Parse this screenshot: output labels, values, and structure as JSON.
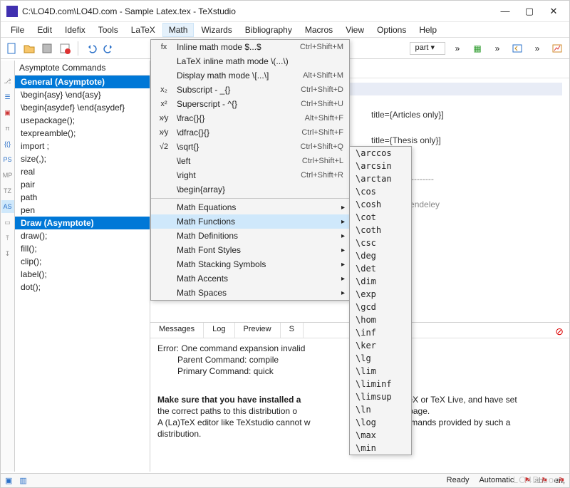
{
  "window": {
    "title": "C:\\LO4D.com\\LO4D.com - Sample Latex.tex - TeXstudio"
  },
  "menu": [
    "File",
    "Edit",
    "Idefix",
    "Tools",
    "LaTeX",
    "Math",
    "Wizards",
    "Bibliography",
    "Macros",
    "View",
    "Options",
    "Help"
  ],
  "toolbar_select": "part",
  "cmds": {
    "header": "Asymptote Commands",
    "items": [
      {
        "label": "General (Asymptote)",
        "group": true
      },
      {
        "label": "\\begin{asy} \\end{asy}"
      },
      {
        "label": "\\begin{asydef} \\end{asydef}"
      },
      {
        "label": "usepackage();"
      },
      {
        "label": "texpreamble();"
      },
      {
        "label": "import ;"
      },
      {
        "label": "size(,);"
      },
      {
        "label": "real"
      },
      {
        "label": "pair"
      },
      {
        "label": "path"
      },
      {
        "label": "pen"
      },
      {
        "label": "Draw (Asymptote)",
        "group": true
      },
      {
        "label": "draw();"
      },
      {
        "label": "fill();"
      },
      {
        "label": "clip();"
      },
      {
        "label": "label();"
      },
      {
        "label": "dot();"
      }
    ]
  },
  "left_icons": [
    "⎇",
    "☰",
    "▣",
    "π",
    "{(}",
    "PS",
    "MP",
    "TZ",
    "AS",
    "▭",
    "⤒",
    "↧"
  ],
  "math_menu": [
    {
      "icon": "fx",
      "label": "Inline math mode $...$",
      "sc": "Ctrl+Shift+M"
    },
    {
      "icon": "",
      "label": "LaTeX inline math mode \\(...\\)",
      "sc": ""
    },
    {
      "icon": "",
      "label": "Display math mode \\[...\\]",
      "sc": "Alt+Shift+M"
    },
    {
      "icon": "x₂",
      "label": "Subscript - _{}",
      "sc": "Ctrl+Shift+D"
    },
    {
      "icon": "x²",
      "label": "Superscript - ^{}",
      "sc": "Ctrl+Shift+U"
    },
    {
      "icon": "x⁄y",
      "label": "\\frac{}{}",
      "sc": "Alt+Shift+F"
    },
    {
      "icon": "x⁄y",
      "label": "\\dfrac{}{}",
      "sc": "Ctrl+Shift+F"
    },
    {
      "icon": "√2",
      "label": "\\sqrt{}",
      "sc": "Ctrl+Shift+Q"
    },
    {
      "icon": "",
      "label": "\\left",
      "sc": "Ctrl+Shift+L"
    },
    {
      "icon": "",
      "label": "\\right",
      "sc": "Ctrl+Shift+R"
    },
    {
      "icon": "",
      "label": "\\begin{array}",
      "sc": ""
    }
  ],
  "math_submenus": [
    {
      "label": "Math Equations"
    },
    {
      "label": "Math Functions",
      "active": true
    },
    {
      "label": "Math Definitions"
    },
    {
      "label": "Math Font Styles"
    },
    {
      "label": "Math Stacking Symbols"
    },
    {
      "label": "Math Accents"
    },
    {
      "label": "Math Spaces"
    }
  ],
  "math_functions": [
    "\\arccos",
    "\\arcsin",
    "\\arctan",
    "\\cos",
    "\\cosh",
    "\\cot",
    "\\coth",
    "\\csc",
    "\\deg",
    "\\det",
    "\\dim",
    "\\exp",
    "\\gcd",
    "\\hom",
    "\\inf",
    "\\ker",
    "\\lg",
    "\\lim",
    "\\liminf",
    "\\limsup",
    "\\ln",
    "\\log",
    "\\max",
    "\\min"
  ],
  "editor": {
    "brace": "}",
    "line1": "title={Articles only}]",
    "line2": "title={Thesis only}]",
    "dashes": "----------------------",
    "comment": "ion with Mendeley"
  },
  "msg_tabs": [
    "Messages",
    "Log",
    "Preview",
    "S"
  ],
  "msg": {
    "l1": "Error: One command expansion invalid",
    "l2": "Parent Command: compile",
    "l3": "Primary Command: quick",
    "p1a": "Make sure that you have installed a",
    "p1b": "on e.g. MiKTeX or TeX Live, and have set",
    "p2a": "the correct paths to this distribution o",
    "p2b": "nfiguration page.",
    "p3a": "A (La)TeX editor like TeXstudio cannot w",
    "p3b": "La)TeX commands provided by such a",
    "p4": "distribution."
  },
  "status": {
    "abc": "abc",
    "lang": "en,",
    "ready": "Ready",
    "auto": "Automatic"
  },
  "watermark": "LO4D.com"
}
